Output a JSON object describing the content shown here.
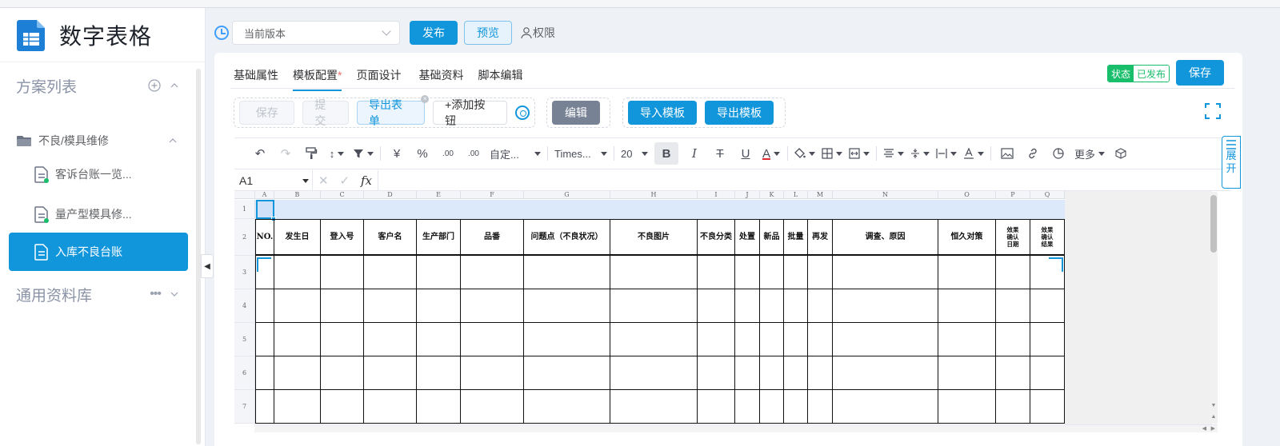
{
  "app": {
    "title": "数字表格",
    "brand_color": "#1296db"
  },
  "sidebar": {
    "scheme_list": {
      "label": "方案列表",
      "add_icon": "plus-circle-icon",
      "collapse_icon": "chevron-up-icon"
    },
    "folder": {
      "label": "不良/模具维修",
      "icon": "folder-icon"
    },
    "items": [
      {
        "label": "客诉台账一览...",
        "active": false
      },
      {
        "label": "量产型模具修...",
        "active": false
      },
      {
        "label": "入库不良台账",
        "active": true
      }
    ],
    "library": {
      "label": "通用资料库",
      "more_icon": "more-horizontal-icon"
    }
  },
  "topbar": {
    "version_select": {
      "value": "当前版本"
    },
    "publish_label": "发布",
    "preview_label": "预览",
    "permission_label": "权限"
  },
  "tabs": [
    {
      "label": "基础属性",
      "active": false,
      "star": ""
    },
    {
      "label": "模板配置",
      "active": true,
      "star": "*"
    },
    {
      "label": "页面设计",
      "active": false,
      "star": ""
    },
    {
      "label": "基础资料",
      "active": false,
      "star": ""
    },
    {
      "label": "脚本编辑",
      "active": false,
      "star": ""
    }
  ],
  "status": {
    "key": "状态",
    "value": "已发布",
    "color": "#19be6b"
  },
  "save_label": "保存",
  "action_group": {
    "save_label": "保存",
    "submit_label": "提交",
    "export_form_label": "导出表单",
    "add_button_label": "+添加按钮"
  },
  "edit_label": "编辑",
  "import_template_label": "导入模板",
  "export_template_label": "导出模板",
  "toolbar": {
    "number_format": "自定...",
    "font_family": "Times...",
    "font_size": "20",
    "more_label": "更多",
    "percent": "%",
    "currency": "¥",
    "dec_decrease": ".00",
    "dec_increase": ".00"
  },
  "expand_label": [
    "展",
    "开"
  ],
  "formula_bar": {
    "cell_ref": "A1",
    "fx": "fx",
    "value": ""
  },
  "sheet": {
    "columns": [
      "A",
      "B",
      "C",
      "D",
      "E",
      "F",
      "G",
      "H",
      "I",
      "J",
      "K",
      "L",
      "M",
      "N",
      "O",
      "P",
      "Q"
    ],
    "rows": [
      "1",
      "2",
      "3",
      "4",
      "5",
      "6",
      "7"
    ],
    "headers": [
      "NO.",
      "发生日",
      "登入号",
      "客户名",
      "生产部门",
      "品番",
      "问题点（不良状况）",
      "不良图片",
      "不良分类",
      "处置",
      "新品",
      "批量",
      "再发",
      "调查、原因",
      "恒久对策",
      "效果\n确认\n日期",
      "效果\n确认\n结果"
    ]
  }
}
